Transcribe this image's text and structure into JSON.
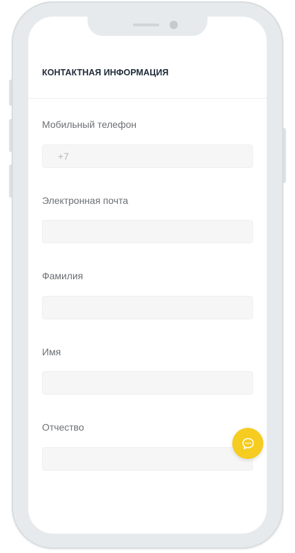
{
  "header": {
    "title": "КОНТАКТНАЯ ИНФОРМАЦИЯ"
  },
  "form": {
    "phone": {
      "label": "Мобильный телефон",
      "placeholder": "+7",
      "value": ""
    },
    "email": {
      "label": "Электронная почта",
      "placeholder": "",
      "value": ""
    },
    "last_name": {
      "label": "Фамилия",
      "placeholder": "",
      "value": ""
    },
    "first_name": {
      "label": "Имя",
      "placeholder": "",
      "value": ""
    },
    "middle_name": {
      "label": "Отчество",
      "placeholder": "",
      "value": ""
    }
  },
  "chat": {
    "icon": "chat-bubble-icon",
    "color": "#f5cc1f"
  },
  "colors": {
    "frame": "#e6eaec",
    "input_bg": "#f6f6f6",
    "title": "#1f2a37",
    "label": "#6b6f74"
  }
}
